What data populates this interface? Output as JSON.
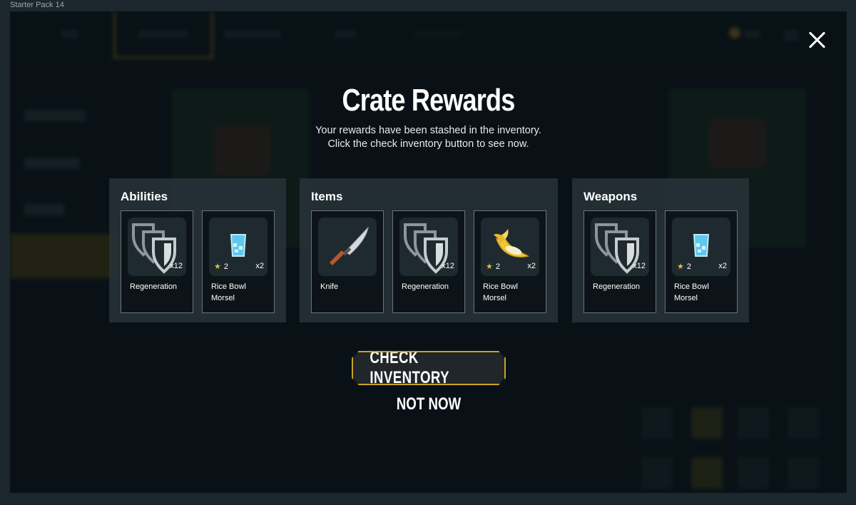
{
  "window": {
    "title": "Starter Pack 14"
  },
  "modal": {
    "title": "Crate Rewards",
    "subtitle_line1": "Your rewards have been stashed in the inventory.",
    "subtitle_line2": "Click the check inventory button to see now.",
    "close_icon": "close-icon"
  },
  "panels": [
    {
      "title": "Abilities",
      "rewards": [
        {
          "name": "Regeneration",
          "icon": "shield-stack-icon",
          "quantity": "x12"
        },
        {
          "name": "Rice Bowl Morsel",
          "icon": "water-glass-icon",
          "level": "2",
          "quantity": "x2"
        }
      ]
    },
    {
      "title": "Items",
      "rewards": [
        {
          "name": "Knife",
          "icon": "knife-icon"
        },
        {
          "name": "Regeneration",
          "icon": "shield-stack-icon",
          "quantity": "x12"
        },
        {
          "name": "Rice Bowl Morsel",
          "icon": "banana-icon",
          "level": "2",
          "quantity": "x2"
        }
      ]
    },
    {
      "title": "Weapons",
      "rewards": [
        {
          "name": "Regeneration",
          "icon": "shield-stack-icon",
          "quantity": "x12"
        },
        {
          "name": "Rice Bowl Morsel",
          "icon": "water-glass-icon",
          "level": "2",
          "quantity": "x2"
        }
      ]
    }
  ],
  "actions": {
    "check_inventory": "CHECK INVENTORY",
    "not_now": "NOT NOW"
  },
  "colors": {
    "accent_gold": "#c9a227",
    "panel_bg": "#28343a",
    "card_bg": "#0d1419"
  }
}
